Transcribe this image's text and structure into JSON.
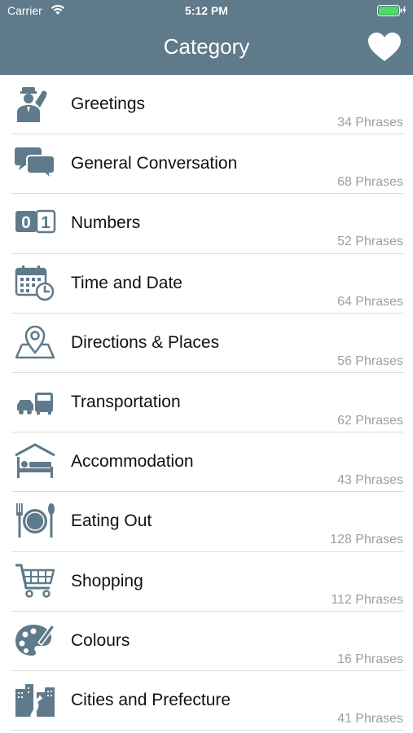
{
  "status_bar": {
    "carrier": "Carrier",
    "time": "5:12 PM",
    "wifi_icon": "wifi-icon",
    "battery_icon": "battery-icon"
  },
  "header": {
    "title": "Category",
    "favorites_icon": "heart-icon",
    "background_color": "#5f7a8a"
  },
  "categories": [
    {
      "label": "Greetings",
      "count": "34 Phrases",
      "icon": "person-saluting-icon"
    },
    {
      "label": "General Conversation",
      "count": "68 Phrases",
      "icon": "chat-bubbles-icon"
    },
    {
      "label": "Numbers",
      "count": "52 Phrases",
      "icon": "numbers-01-icon"
    },
    {
      "label": "Time and Date",
      "count": "64 Phrases",
      "icon": "calendar-clock-icon"
    },
    {
      "label": "Directions & Places",
      "count": "56 Phrases",
      "icon": "map-pin-icon"
    },
    {
      "label": "Transportation",
      "count": "62 Phrases",
      "icon": "vehicles-icon"
    },
    {
      "label": "Accommodation",
      "count": "43 Phrases",
      "icon": "bed-house-icon"
    },
    {
      "label": "Eating Out",
      "count": "128 Phrases",
      "icon": "plate-fork-spoon-icon"
    },
    {
      "label": "Shopping",
      "count": "112 Phrases",
      "icon": "shopping-cart-icon"
    },
    {
      "label": "Colours",
      "count": "16 Phrases",
      "icon": "palette-icon"
    },
    {
      "label": "Cities and Prefecture",
      "count": "41 Phrases",
      "icon": "city-buildings-icon"
    }
  ],
  "icon_color": "#5f7a8a"
}
